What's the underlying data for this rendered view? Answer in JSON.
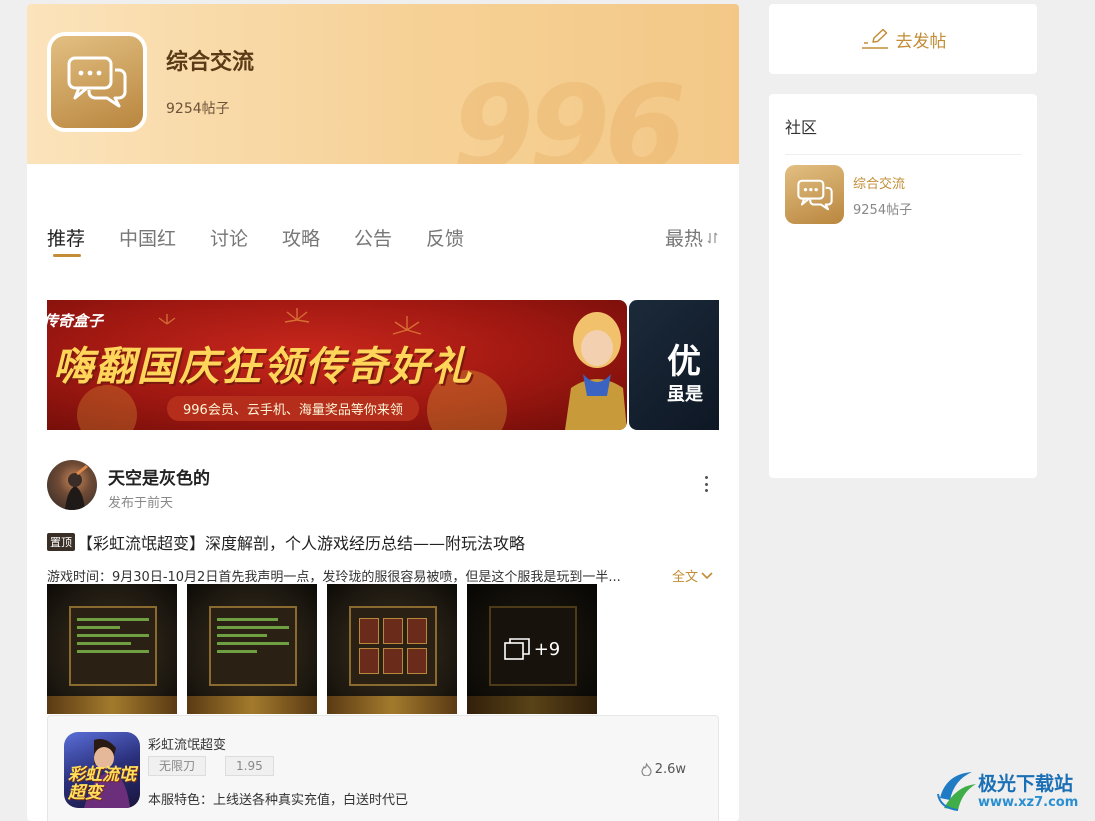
{
  "forum": {
    "title": "综合交流",
    "post_count": "9254帖子",
    "watermark": "996"
  },
  "tabs": [
    {
      "label": "推荐",
      "active": true
    },
    {
      "label": "中国红",
      "active": false
    },
    {
      "label": "讨论",
      "active": false
    },
    {
      "label": "攻略",
      "active": false
    },
    {
      "label": "公告",
      "active": false
    },
    {
      "label": "反馈",
      "active": false
    }
  ],
  "sort": {
    "label": "最热",
    "icon": "sort-icon"
  },
  "banner": {
    "brand": "传奇盒子",
    "headline": "嗨翻国庆狂领传奇好礼",
    "subline": "996会员、云手机、海量奖品等你来领",
    "side_headline": "优",
    "side_subline": "虽是"
  },
  "post": {
    "author": "天空是灰色的",
    "time": "发布于前天",
    "pin_label": "置顶",
    "title": "【彩虹流氓超变】深度解剖，个人游戏经历总结——附玩法攻略",
    "excerpt": "游戏时间：9月30日-10月2日首先我声明一点，发玲珑的服很容易被喷，但是这个服我是玩到一半...",
    "fulltext_label": "全文",
    "more_images": "+9"
  },
  "game": {
    "name": "彩虹流氓超变",
    "icon_text": "彩虹流氓超变",
    "tags": [
      "无限刀",
      "1.95"
    ],
    "hot": "2.6w",
    "desc": "本服特色：上线送各种真实充值，白送时代已"
  },
  "sidebar": {
    "post_button": "去发帖",
    "community_title": "社区",
    "item_name": "综合交流",
    "item_count": "9254帖子"
  },
  "logo": {
    "title": "极光下载站",
    "url": "www.xz7.com"
  },
  "colors": {
    "accent": "#c28d36",
    "hero_bg": "#f6d196"
  }
}
